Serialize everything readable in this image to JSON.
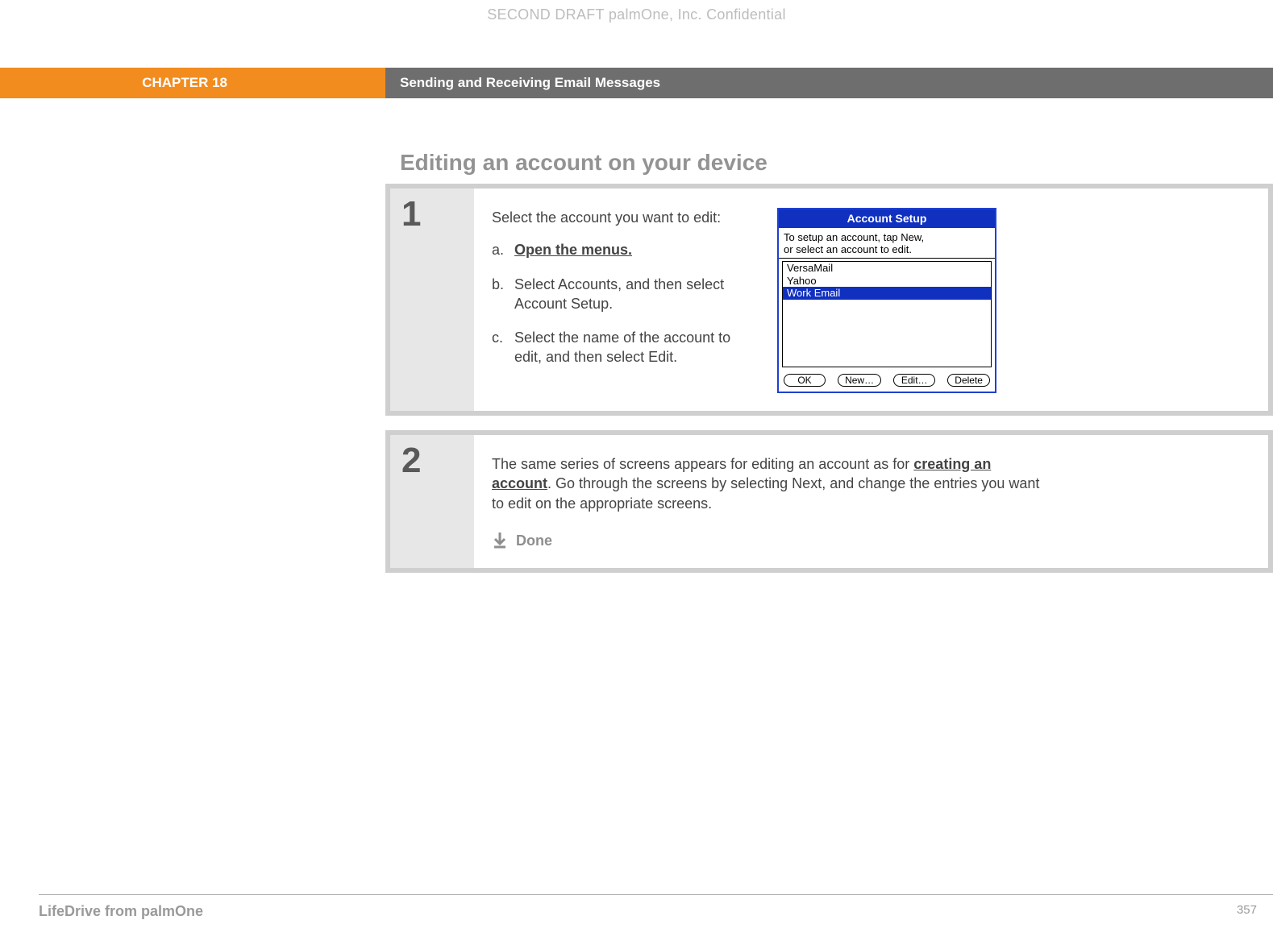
{
  "watermark": "SECOND DRAFT palmOne, Inc.  Confidential",
  "header": {
    "chapter": "CHAPTER 18",
    "title": "Sending and Receiving Email Messages"
  },
  "section_heading": "Editing an account on your device",
  "step1": {
    "number": "1",
    "intro": "Select the account you want to edit:",
    "a_marker": "a.",
    "a_link": "Open the menus.",
    "b_marker": "b.",
    "b_text": "Select Accounts, and then select Account Setup.",
    "c_marker": "c.",
    "c_text": "Select the name of the account to edit, and then select Edit."
  },
  "device": {
    "title": "Account Setup",
    "hint_line1": "To setup an account, tap New,",
    "hint_line2": "or select an account to edit.",
    "items": {
      "0": "VersaMail",
      "1": "Yahoo",
      "2": "Work Email"
    },
    "buttons": {
      "ok": "OK",
      "new": "New…",
      "edit": "Edit…",
      "delete": "Delete"
    }
  },
  "step2": {
    "number": "2",
    "text_before": "The same series of screens appears for editing an account as for ",
    "link": "creating an account",
    "text_after": ". Go through the screens by selecting Next, and change the entries you want to edit on the appropriate screens.",
    "done_label": "Done"
  },
  "footer": {
    "product": "LifeDrive from palmOne",
    "page": "357"
  }
}
